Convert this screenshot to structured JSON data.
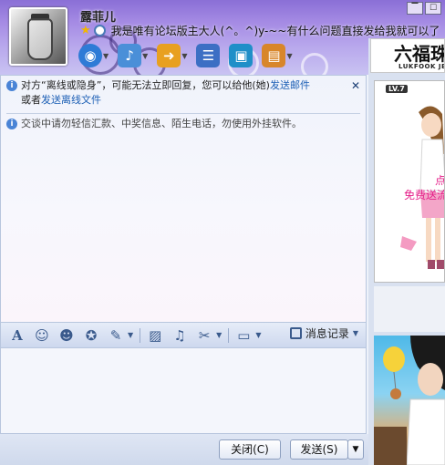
{
  "header": {
    "nickname": "露菲儿",
    "signature": "我是唯有论坛版主大人(^。^)y-~~有什么问题直接发给我就可以了",
    "window_controls": [
      "▔",
      "☐"
    ]
  },
  "toolbar": {
    "icons": [
      {
        "name": "video-call-icon",
        "color": "#2e7bd6",
        "glyph": "◉"
      },
      {
        "name": "voice-call-icon",
        "color": "#4a8fd8",
        "glyph": "♪"
      },
      {
        "name": "send-file-icon",
        "color": "#e8a020",
        "glyph": "➜"
      },
      {
        "name": "create-group-icon",
        "color": "#3c6fc4",
        "glyph": "☰"
      },
      {
        "name": "remote-assist-icon",
        "color": "#1f8fc8",
        "glyph": "▣"
      },
      {
        "name": "apps-icon",
        "color": "#d8862a",
        "glyph": "▤"
      }
    ]
  },
  "messages": {
    "offline_notice_prefix": "对方“离线或隐身”，可能无法立即回复，您可以给他(她)",
    "send_email_link": "发送邮件",
    "offline_notice_or": "或者",
    "send_offline_file_link": "发送离线文件",
    "safety_notice": "交谈中请勿轻信汇款、中奖信息、陌生电话，勿使用外挂软件。"
  },
  "format_toolbar": {
    "history_label": "消息记录"
  },
  "bottom_bar": {
    "close_label": "关闭(C)",
    "send_label": "发送(S)"
  },
  "right_panel": {
    "ad_title": "六福珠",
    "ad_subtitle": "LUKFOOK JE",
    "level_badge": "LV.7",
    "show_text1": "点此",
    "show_text2": "免费送流"
  }
}
